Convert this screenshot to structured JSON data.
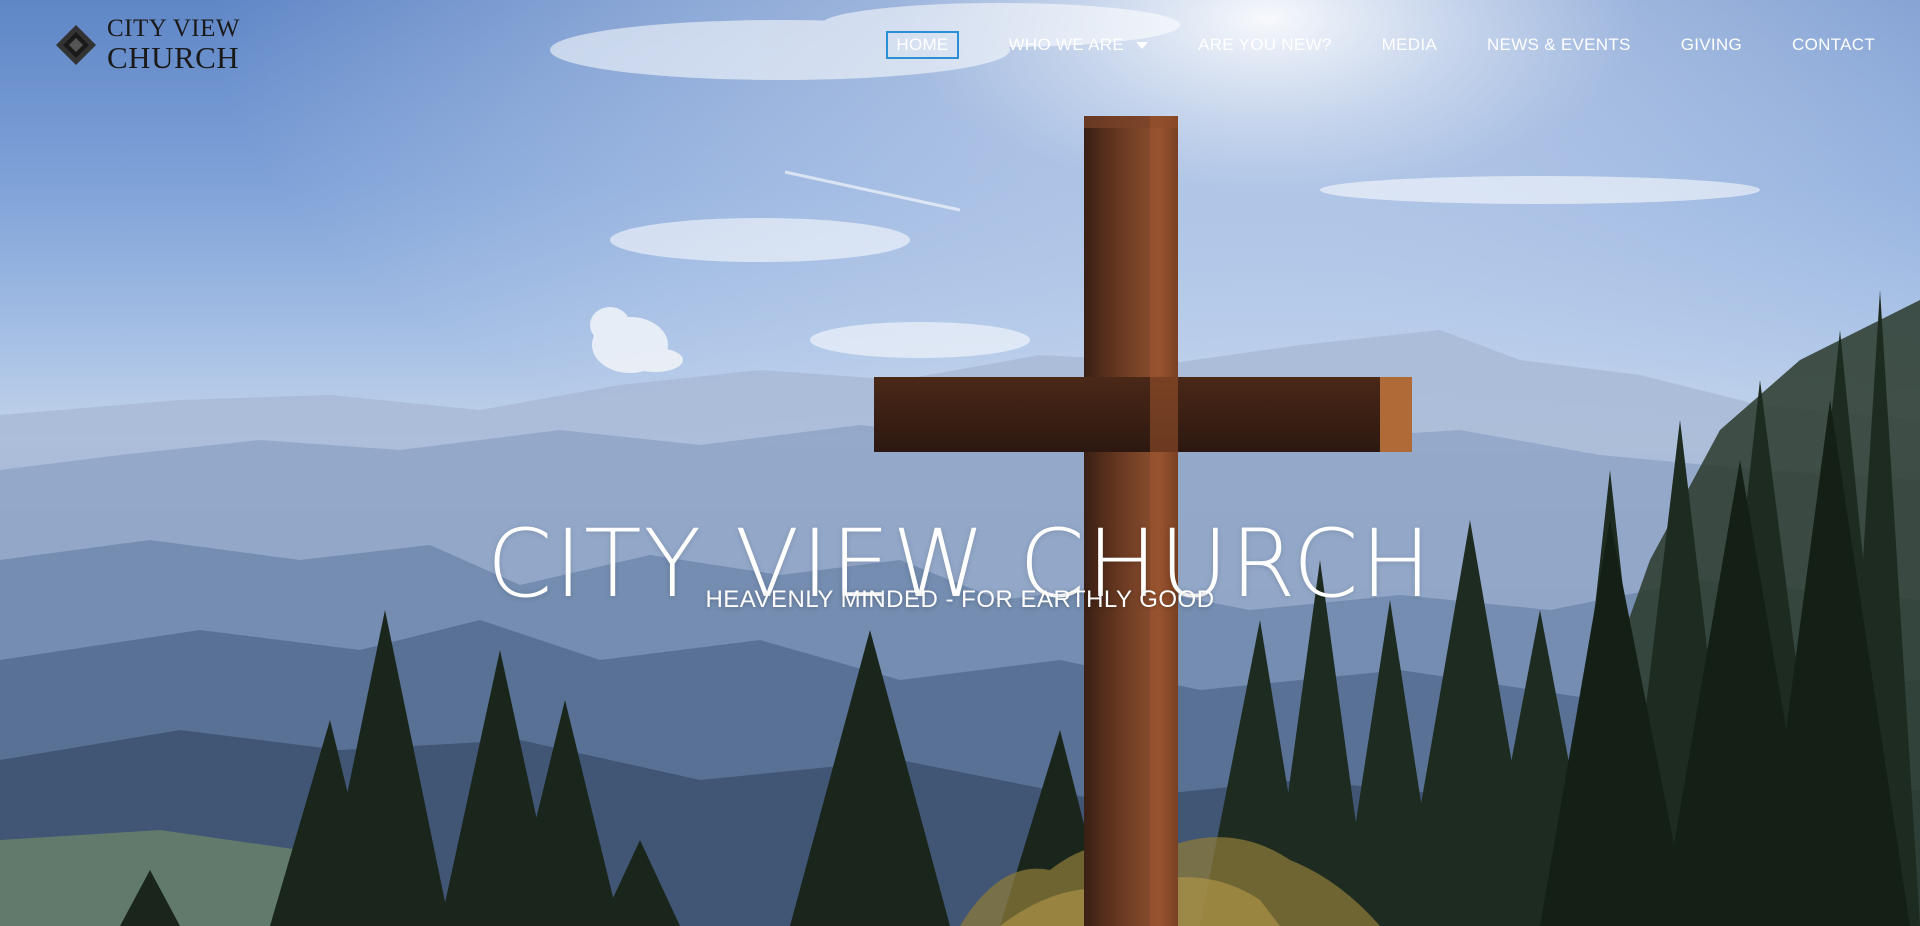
{
  "site": {
    "logo": {
      "line1": "CITY VIEW",
      "line2": "CHURCH",
      "icon": "diamond-logo-icon",
      "color": "#1a1a1a"
    }
  },
  "nav": {
    "items": [
      {
        "label": "HOME",
        "active": true
      },
      {
        "label": "WHO WE ARE",
        "dropdown": true
      },
      {
        "label": "ARE YOU NEW?"
      },
      {
        "label": "MEDIA"
      },
      {
        "label": "NEWS & EVENTS"
      },
      {
        "label": "GIVING"
      },
      {
        "label": "CONTACT"
      }
    ],
    "active_outline_color": "#2b8fd6",
    "dropdown_icon": "caret-down-icon"
  },
  "hero": {
    "title": "CITY VIEW CHURCH",
    "subtitle": "HEAVENLY MINDED - FOR EARTHLY GOOD",
    "background": "mountain-landscape-with-wooden-cross-image"
  }
}
